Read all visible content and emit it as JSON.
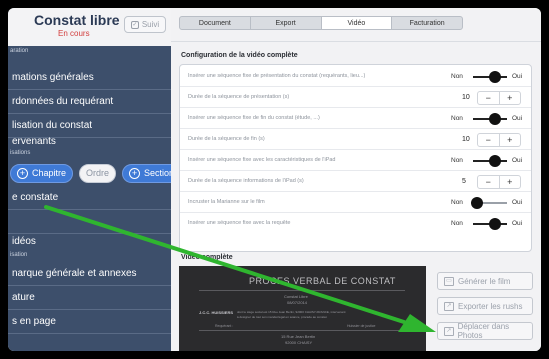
{
  "sidebar": {
    "title": "Constat libre",
    "status": "En cours",
    "suivi_label": "Suivi",
    "section_top": "aration",
    "section_mid": "isations",
    "section_video": "isation",
    "items": [
      {
        "label": "mations générales"
      },
      {
        "label": "rdonnées du requérant"
      },
      {
        "label": "lisation du constat"
      },
      {
        "label": "ervenants"
      },
      {
        "label": "e constate"
      },
      {
        "label": ""
      },
      {
        "label": "idéos"
      },
      {
        "label": "narque générale et annexes"
      },
      {
        "label": "ature"
      },
      {
        "label": "s en page"
      }
    ],
    "tools": {
      "chapitre": "Chapitre",
      "ordre": "Ordre",
      "section": "Section"
    }
  },
  "tabs": [
    {
      "label": "Document",
      "active": false
    },
    {
      "label": "Export",
      "active": false
    },
    {
      "label": "Vidéo",
      "active": true
    },
    {
      "label": "Facturation",
      "active": false
    }
  ],
  "config": {
    "title": "Configuration de la vidéo complète",
    "rows": [
      {
        "label": "Insérer une séquence fixe de présentation du constat (requérants, lieu...)",
        "type": "toggle",
        "off": "Non",
        "on": "Oui",
        "state": "on"
      },
      {
        "label": "Durée de la séquence de présentation (s)",
        "type": "stepper",
        "value": "10",
        "minus": "−",
        "plus": "+"
      },
      {
        "label": "Insérer une séquence fixe de fin du constat (étude, ...)",
        "type": "toggle",
        "off": "Non",
        "on": "Oui",
        "state": "on"
      },
      {
        "label": "Durée de la séquence de fin (s)",
        "type": "stepper",
        "value": "10",
        "minus": "−",
        "plus": "+"
      },
      {
        "label": "Insérer une séquence fixe avec les caractéristiques de l'iPad",
        "type": "toggle",
        "off": "Non",
        "on": "Oui",
        "state": "on"
      },
      {
        "label": "Durée de la séquence informations de l'iPad (s)",
        "type": "stepper",
        "value": "5",
        "minus": "−",
        "plus": "+"
      },
      {
        "label": "Incruster la Marianne sur le film",
        "type": "toggle",
        "off": "Non",
        "on": "Oui",
        "state": "off"
      },
      {
        "label": "Insérer une séquence fixe avec la requête",
        "type": "toggle",
        "off": "Non",
        "on": "Oui",
        "state": "on"
      }
    ]
  },
  "video": {
    "title": "Vidéo complète",
    "preview_title": "PROCES VERBAL DE CONSTAT",
    "preview_sub": "Constat Libre",
    "preview_date": "08/07/2014",
    "preview_firm": "J.C.C. HUISSIERS",
    "preview_body_1": "dont le siège social est 15 Rue Jean Bertin, 92000 CHAISY-FRANCE, intervenant",
    "preview_body_2": "à désigner de tout son mandat légal en séance, procède au constat",
    "preview_addr_1": "15 Rue Jean Bertin",
    "preview_addr_2": "92000 CHAISY",
    "label_left": "Requérant :",
    "label_right": "Huissier de justice",
    "actions": {
      "generate": "Générer le film",
      "export": "Exporter les rushs",
      "move": "Déplacer dans Photos"
    }
  },
  "colors": {
    "sidebar_bg": "#3d4f6b",
    "status_red": "#d23c3c",
    "accent_blue": "#3f7ad6",
    "arrow_green": "#2fb52f"
  }
}
